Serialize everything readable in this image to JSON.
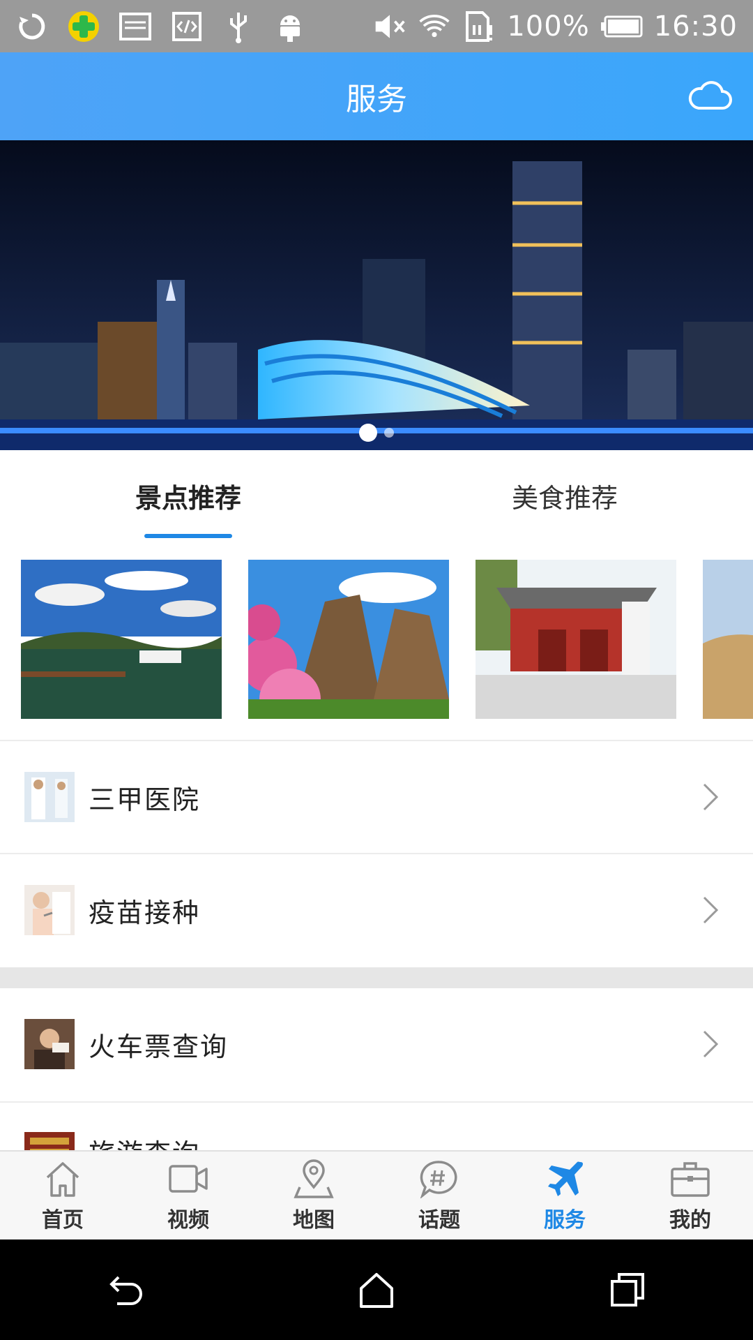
{
  "status_bar": {
    "battery_percent": "100%",
    "time": "16:30",
    "icons": [
      "sync-icon",
      "security-app-icon",
      "image-icon",
      "code-icon",
      "usb-icon",
      "android-icon",
      "mute-icon",
      "wifi-icon",
      "sim-alert-icon",
      "battery-icon"
    ]
  },
  "header": {
    "title": "服务",
    "right_icon": "cloud-icon"
  },
  "banner": {
    "slide_count": 2,
    "active_index": 0
  },
  "tabs": [
    {
      "label": "景点推荐",
      "active": true
    },
    {
      "label": "美食推荐",
      "active": false
    }
  ],
  "list_group_1": [
    {
      "label": "三甲医院",
      "icon": "hospital-thumb"
    },
    {
      "label": "疫苗接种",
      "icon": "vaccine-thumb"
    }
  ],
  "list_group_2": [
    {
      "label": "火车票查询",
      "icon": "train-ticket-thumb"
    },
    {
      "label": "旅游查询",
      "icon": "travel-thumb"
    }
  ],
  "bottom_nav": [
    {
      "label": "首页",
      "icon": "home-icon",
      "active": false
    },
    {
      "label": "视频",
      "icon": "video-icon",
      "active": false
    },
    {
      "label": "地图",
      "icon": "map-pin-icon",
      "active": false
    },
    {
      "label": "话题",
      "icon": "topic-hashtag-icon",
      "active": false
    },
    {
      "label": "服务",
      "icon": "airplane-icon",
      "active": true
    },
    {
      "label": "我的",
      "icon": "briefcase-icon",
      "active": false
    }
  ],
  "colors": {
    "accent": "#1e88e5",
    "header": "#3aa6fb",
    "status_bar": "#9a9a9a"
  }
}
